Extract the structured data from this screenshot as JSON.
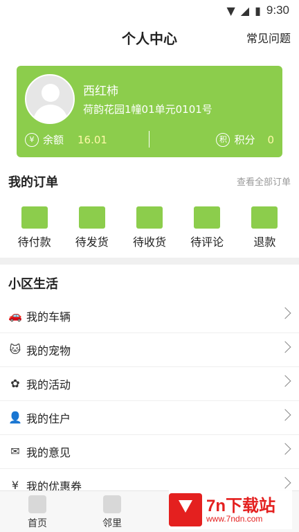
{
  "status_bar": {
    "time": "9:30"
  },
  "header": {
    "title": "个人中心",
    "faq": "常见问题"
  },
  "user_card": {
    "name": "西红柿",
    "address": "荷韵花园1幢01单元0101号",
    "balance_icon": "¥",
    "balance_label": "余额",
    "balance_value": "16.01",
    "points_icon": "积",
    "points_label": "积分",
    "points_value": "0",
    "accent": "#8ccd4c"
  },
  "orders": {
    "title": "我的订单",
    "view_all": "查看全部订单",
    "items": [
      {
        "label": "待付款",
        "icon": "wallet-icon"
      },
      {
        "label": "待发货",
        "icon": "truck-icon"
      },
      {
        "label": "待收货",
        "icon": "box-check-icon"
      },
      {
        "label": "待评论",
        "icon": "comment-edit-icon"
      },
      {
        "label": "退款",
        "icon": "refund-icon"
      }
    ]
  },
  "community": {
    "title": "小区生活",
    "items": [
      {
        "label": "我的车辆",
        "icon": "car-icon",
        "glyph": "🚗"
      },
      {
        "label": "我的宠物",
        "icon": "cat-icon",
        "glyph": "🐱"
      },
      {
        "label": "我的活动",
        "icon": "activity-icon",
        "glyph": "✿"
      },
      {
        "label": "我的住户",
        "icon": "resident-icon",
        "glyph": "👤"
      },
      {
        "label": "我的意见",
        "icon": "feedback-icon",
        "glyph": "✉"
      },
      {
        "label": "我的优惠券",
        "icon": "coupon-icon",
        "glyph": "¥"
      }
    ]
  },
  "tabbar": [
    {
      "label": "首页",
      "icon": "home-icon"
    },
    {
      "label": "邻里",
      "icon": "neighbor-icon"
    }
  ],
  "watermark": {
    "line1": "7n下载站",
    "line2": "www.7ndn.com"
  }
}
